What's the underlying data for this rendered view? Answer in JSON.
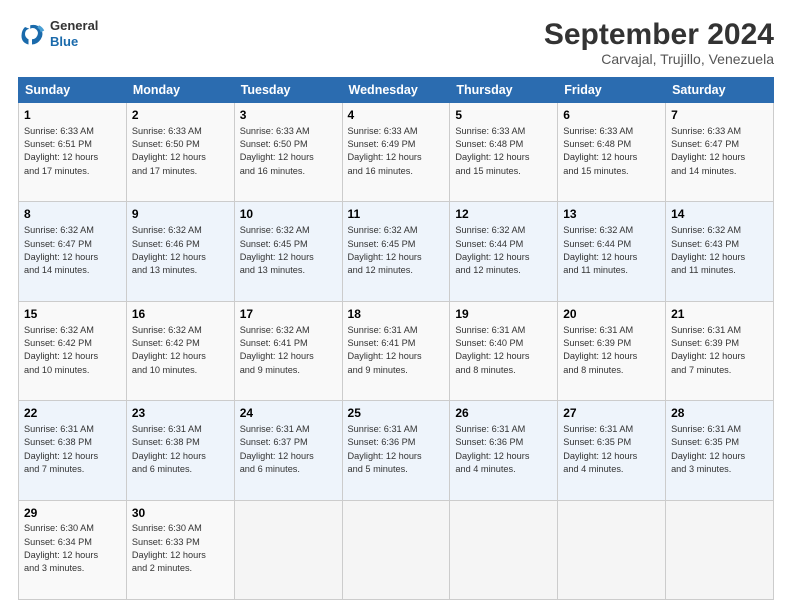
{
  "logo": {
    "line1": "General",
    "line2": "Blue"
  },
  "title": "September 2024",
  "subtitle": "Carvajal, Trujillo, Venezuela",
  "days_of_week": [
    "Sunday",
    "Monday",
    "Tuesday",
    "Wednesday",
    "Thursday",
    "Friday",
    "Saturday"
  ],
  "weeks": [
    [
      {
        "day": "1",
        "info": "Sunrise: 6:33 AM\nSunset: 6:51 PM\nDaylight: 12 hours\nand 17 minutes."
      },
      {
        "day": "2",
        "info": "Sunrise: 6:33 AM\nSunset: 6:50 PM\nDaylight: 12 hours\nand 17 minutes."
      },
      {
        "day": "3",
        "info": "Sunrise: 6:33 AM\nSunset: 6:50 PM\nDaylight: 12 hours\nand 16 minutes."
      },
      {
        "day": "4",
        "info": "Sunrise: 6:33 AM\nSunset: 6:49 PM\nDaylight: 12 hours\nand 16 minutes."
      },
      {
        "day": "5",
        "info": "Sunrise: 6:33 AM\nSunset: 6:48 PM\nDaylight: 12 hours\nand 15 minutes."
      },
      {
        "day": "6",
        "info": "Sunrise: 6:33 AM\nSunset: 6:48 PM\nDaylight: 12 hours\nand 15 minutes."
      },
      {
        "day": "7",
        "info": "Sunrise: 6:33 AM\nSunset: 6:47 PM\nDaylight: 12 hours\nand 14 minutes."
      }
    ],
    [
      {
        "day": "8",
        "info": "Sunrise: 6:32 AM\nSunset: 6:47 PM\nDaylight: 12 hours\nand 14 minutes."
      },
      {
        "day": "9",
        "info": "Sunrise: 6:32 AM\nSunset: 6:46 PM\nDaylight: 12 hours\nand 13 minutes."
      },
      {
        "day": "10",
        "info": "Sunrise: 6:32 AM\nSunset: 6:45 PM\nDaylight: 12 hours\nand 13 minutes."
      },
      {
        "day": "11",
        "info": "Sunrise: 6:32 AM\nSunset: 6:45 PM\nDaylight: 12 hours\nand 12 minutes."
      },
      {
        "day": "12",
        "info": "Sunrise: 6:32 AM\nSunset: 6:44 PM\nDaylight: 12 hours\nand 12 minutes."
      },
      {
        "day": "13",
        "info": "Sunrise: 6:32 AM\nSunset: 6:44 PM\nDaylight: 12 hours\nand 11 minutes."
      },
      {
        "day": "14",
        "info": "Sunrise: 6:32 AM\nSunset: 6:43 PM\nDaylight: 12 hours\nand 11 minutes."
      }
    ],
    [
      {
        "day": "15",
        "info": "Sunrise: 6:32 AM\nSunset: 6:42 PM\nDaylight: 12 hours\nand 10 minutes."
      },
      {
        "day": "16",
        "info": "Sunrise: 6:32 AM\nSunset: 6:42 PM\nDaylight: 12 hours\nand 10 minutes."
      },
      {
        "day": "17",
        "info": "Sunrise: 6:32 AM\nSunset: 6:41 PM\nDaylight: 12 hours\nand 9 minutes."
      },
      {
        "day": "18",
        "info": "Sunrise: 6:31 AM\nSunset: 6:41 PM\nDaylight: 12 hours\nand 9 minutes."
      },
      {
        "day": "19",
        "info": "Sunrise: 6:31 AM\nSunset: 6:40 PM\nDaylight: 12 hours\nand 8 minutes."
      },
      {
        "day": "20",
        "info": "Sunrise: 6:31 AM\nSunset: 6:39 PM\nDaylight: 12 hours\nand 8 minutes."
      },
      {
        "day": "21",
        "info": "Sunrise: 6:31 AM\nSunset: 6:39 PM\nDaylight: 12 hours\nand 7 minutes."
      }
    ],
    [
      {
        "day": "22",
        "info": "Sunrise: 6:31 AM\nSunset: 6:38 PM\nDaylight: 12 hours\nand 7 minutes."
      },
      {
        "day": "23",
        "info": "Sunrise: 6:31 AM\nSunset: 6:38 PM\nDaylight: 12 hours\nand 6 minutes."
      },
      {
        "day": "24",
        "info": "Sunrise: 6:31 AM\nSunset: 6:37 PM\nDaylight: 12 hours\nand 6 minutes."
      },
      {
        "day": "25",
        "info": "Sunrise: 6:31 AM\nSunset: 6:36 PM\nDaylight: 12 hours\nand 5 minutes."
      },
      {
        "day": "26",
        "info": "Sunrise: 6:31 AM\nSunset: 6:36 PM\nDaylight: 12 hours\nand 4 minutes."
      },
      {
        "day": "27",
        "info": "Sunrise: 6:31 AM\nSunset: 6:35 PM\nDaylight: 12 hours\nand 4 minutes."
      },
      {
        "day": "28",
        "info": "Sunrise: 6:31 AM\nSunset: 6:35 PM\nDaylight: 12 hours\nand 3 minutes."
      }
    ],
    [
      {
        "day": "29",
        "info": "Sunrise: 6:30 AM\nSunset: 6:34 PM\nDaylight: 12 hours\nand 3 minutes."
      },
      {
        "day": "30",
        "info": "Sunrise: 6:30 AM\nSunset: 6:33 PM\nDaylight: 12 hours\nand 2 minutes."
      },
      {
        "day": "",
        "info": ""
      },
      {
        "day": "",
        "info": ""
      },
      {
        "day": "",
        "info": ""
      },
      {
        "day": "",
        "info": ""
      },
      {
        "day": "",
        "info": ""
      }
    ]
  ]
}
